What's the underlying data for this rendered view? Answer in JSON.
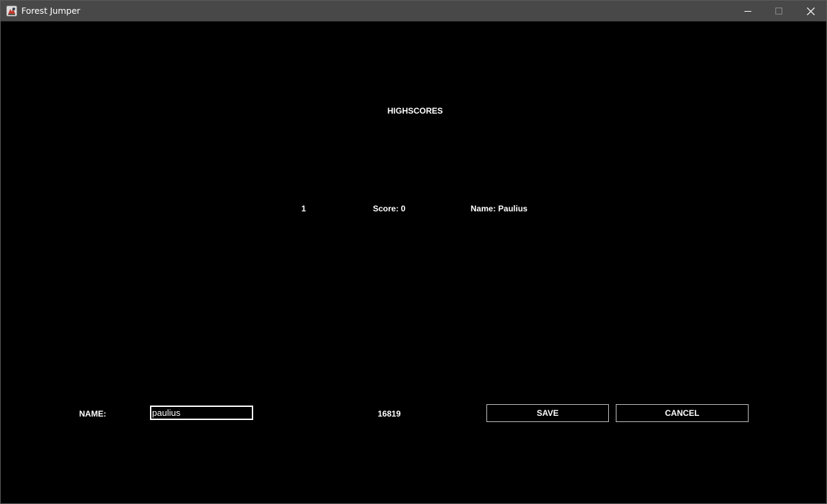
{
  "window": {
    "title": "Forest Jumper",
    "icon": "java-app-icon",
    "controls": [
      "minimize-icon",
      "maximize-icon",
      "close-icon"
    ]
  },
  "highscores": {
    "title": "HIGHSCORES",
    "entries": [
      {
        "rank": "1",
        "score": "Score: 0",
        "name": "Name: Paulius"
      }
    ]
  },
  "entry_form": {
    "name_label": "NAME:",
    "name_value": "paulius",
    "score": "16819",
    "save_label": "SAVE",
    "cancel_label": "CANCEL"
  },
  "colors": {
    "background": "#000000",
    "titlebar": "#484848",
    "text": "#ffffff",
    "button_border": "#bfbfbf"
  }
}
